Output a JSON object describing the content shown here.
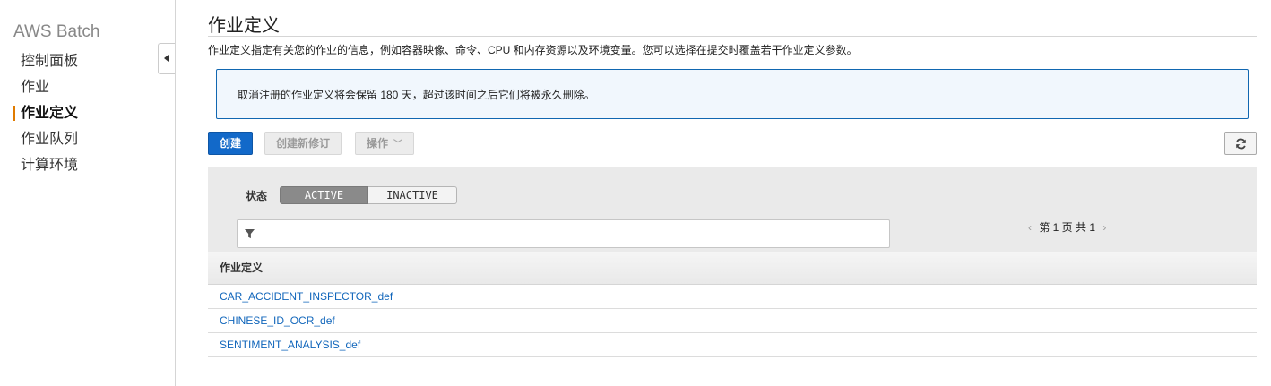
{
  "sidebar": {
    "service_title": "AWS Batch",
    "items": [
      {
        "label": "控制面板"
      },
      {
        "label": "作业"
      },
      {
        "label": "作业定义",
        "active": true
      },
      {
        "label": "作业队列"
      },
      {
        "label": "计算环境"
      }
    ],
    "collapse_icon": "caret-left-icon"
  },
  "main": {
    "title": "作业定义",
    "description": "作业定义指定有关您的作业的信息，例如容器映像、命令、CPU 和内存资源以及环境变量。您可以选择在提交时覆盖若干作业定义参数。",
    "info_message": "取消注册的作业定义将会保留 180 天，超过该时间之后它们将被永久删除。",
    "toolbar": {
      "create_label": "创建",
      "create_revision_label": "创建新修订",
      "actions_label": "操作",
      "refresh_icon": "refresh-icon"
    },
    "filter": {
      "status_label": "状态",
      "status_options": [
        "ACTIVE",
        "INACTIVE"
      ],
      "selected_status": "ACTIVE",
      "search_placeholder": "",
      "search_value": "",
      "filter_icon": "filter-icon"
    },
    "pagination": {
      "text": "第 1 页 共 1",
      "prev_icon": "chevron-left-icon",
      "next_icon": "chevron-right-icon"
    },
    "table": {
      "header": "作业定义",
      "rows": [
        {
          "name": "CAR_ACCIDENT_INSPECTOR_def"
        },
        {
          "name": "CHINESE_ID_OCR_def"
        },
        {
          "name": "SENTIMENT_ANALYSIS_def"
        }
      ]
    }
  },
  "colors": {
    "primary_button": "#1269c9",
    "active_nav_marker": "#e07b00",
    "info_border": "#1167b1",
    "info_background": "#f1f7fd",
    "link": "#1166bb"
  }
}
